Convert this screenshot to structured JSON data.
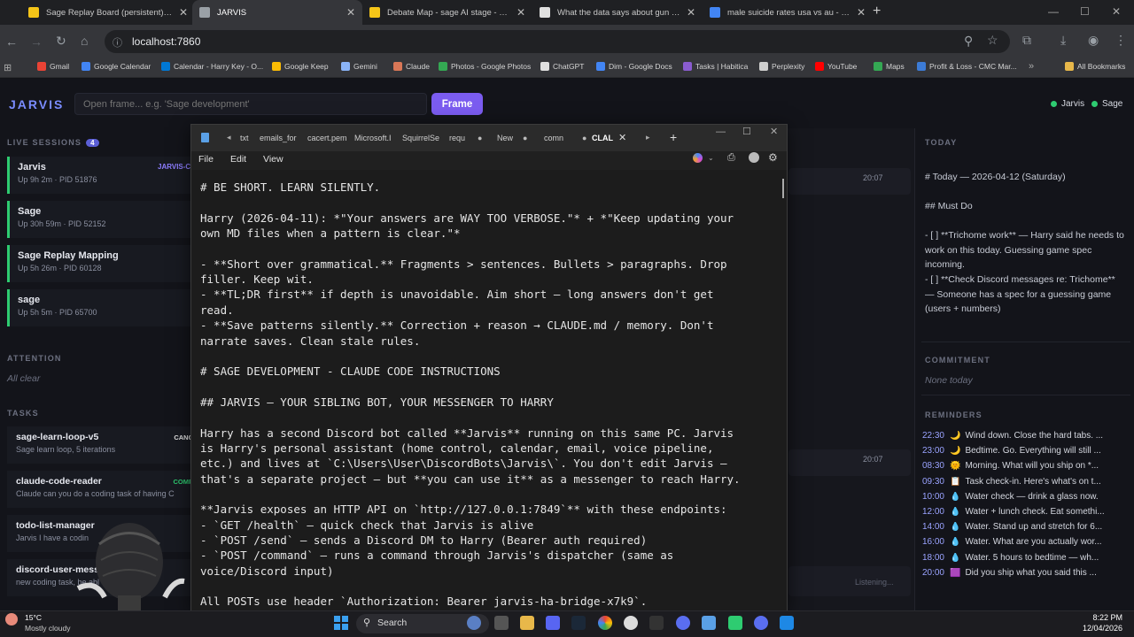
{
  "browser": {
    "tabs": [
      {
        "title": "Sage Replay Board (persistent) - Miro",
        "icon_color": "#f5c518"
      },
      {
        "title": "JARVIS",
        "icon_color": "#9aa0a6",
        "active": true
      },
      {
        "title": "Debate Map - sage AI stage - Miro",
        "icon_color": "#f5c518"
      },
      {
        "title": "What the data says about gun deaths",
        "icon_color": "#e0e0e0"
      },
      {
        "title": "male suicide rates usa vs au - Google",
        "icon_color": "#4285f4"
      }
    ],
    "url": "localhost:7860",
    "bookmarks": [
      {
        "label": "Gmail",
        "color": "#ea4335"
      },
      {
        "label": "Google Calendar",
        "color": "#4285f4"
      },
      {
        "label": "Calendar - Harry Key - O...",
        "color": "#0078d4"
      },
      {
        "label": "Google Keep",
        "color": "#fbbc04"
      },
      {
        "label": "Gemini",
        "color": "#8ab4f8"
      },
      {
        "label": "Claude",
        "color": "#d97757"
      },
      {
        "label": "Photos - Google Photos",
        "color": "#34a853"
      },
      {
        "label": "ChatGPT",
        "color": "#e0e0e0"
      },
      {
        "label": "Dim - Google Docs",
        "color": "#4285f4"
      },
      {
        "label": "Tasks | Habitica",
        "color": "#8a5cd0"
      },
      {
        "label": "Perplexity",
        "color": "#cfcfcf"
      },
      {
        "label": "YouTube",
        "color": "#ff0000"
      },
      {
        "label": "Maps",
        "color": "#34a853"
      },
      {
        "label": "Profit & Loss - CMC Mar...",
        "color": "#3c7bd6"
      }
    ],
    "all_bookmarks": "All Bookmarks"
  },
  "app": {
    "brand": "JARVIS",
    "frame_placeholder": "Open frame... e.g. 'Sage development'",
    "frame_button": "Frame",
    "status": [
      {
        "label": "Jarvis"
      },
      {
        "label": "Sage"
      }
    ]
  },
  "left": {
    "live_sessions_label": "LIVE SESSIONS",
    "live_sessions_count": "4",
    "sessions": [
      {
        "name": "Jarvis",
        "meta": "Up 9h 2m · PID 51876",
        "tag": "JARVIS-C"
      },
      {
        "name": "Sage",
        "meta": "Up 30h 59m · PID 52152"
      },
      {
        "name": "Sage Replay Mapping",
        "meta": "Up 5h 26m · PID 60128"
      },
      {
        "name": "sage",
        "meta": "Up 5h 5m · PID 65700"
      }
    ],
    "attention_label": "ATTENTION",
    "attention_value": "All clear",
    "tasks_label": "TASKS",
    "tasks": [
      {
        "name": "sage-learn-loop-v5",
        "meta": "Sage learn loop, 5 iterations",
        "badge": "CANC",
        "badge_color": "#e0e0e0"
      },
      {
        "name": "claude-code-reader",
        "meta": "Claude can you do a coding task of having C",
        "badge": "COMP",
        "badge_color": "#2ecc71"
      },
      {
        "name": "todo-list-manager",
        "meta": "Jarvis I have a codin",
        "badge": "",
        "badge_color": "#2ecc71"
      },
      {
        "name": "discord-user-messag",
        "meta": "new coding task, be abl",
        "badge": "",
        "badge_color": "#2ecc71"
      }
    ]
  },
  "center": {
    "time1": "20:07",
    "time2": "20:07",
    "listening": "Listening..."
  },
  "notepad": {
    "tabs": [
      "txt",
      "emails_for",
      "cacert.pem",
      "Microsoft.I",
      "SquirrelSe",
      "requ",
      "New",
      "comn",
      "CLAL"
    ],
    "menu": [
      "File",
      "Edit",
      "View"
    ],
    "lines": [
      "# BE SHORT. LEARN SILENTLY.",
      "",
      "Harry (2026-04-11): *\"Your answers are WAY TOO VERBOSE.\"* + *\"Keep updating your",
      "own MD files when a pattern is clear.\"*",
      "",
      "- **Short over grammatical.** Fragments > sentences. Bullets > paragraphs. Drop",
      "filler. Keep wit.",
      "- **TL;DR first** if depth is unavoidable. Aim short — long answers don't get",
      "read.",
      "- **Save patterns silently.** Correction + reason → CLAUDE.md / memory. Don't",
      "narrate saves. Clean stale rules.",
      "",
      "# SAGE DEVELOPMENT - CLAUDE CODE INSTRUCTIONS",
      "",
      "## JARVIS — YOUR SIBLING BOT, YOUR MESSENGER TO HARRY",
      "",
      "Harry has a second Discord bot called **Jarvis** running on this same PC. Jarvis",
      "is Harry's personal assistant (home control, calendar, email, voice pipeline,",
      "etc.) and lives at `C:\\Users\\User\\DiscordBots\\Jarvis\\`. You don't edit Jarvis —",
      "that's a separate project — but **you can use it** as a messenger to reach Harry.",
      "",
      "**Jarvis exposes an HTTP API on `http://127.0.0.1:7849`** with these endpoints:",
      "- `GET /health` — quick check that Jarvis is alive",
      "- `POST /send` — sends a Discord DM to Harry (Bearer auth required)",
      "- `POST /command` — runs a command through Jarvis's dispatcher (same as",
      "voice/Discord input)",
      "",
      "All POSTs use header `Authorization: Bearer jarvis-ha-bridge-x7k9`."
    ]
  },
  "right": {
    "today_label": "TODAY",
    "today_lines": [
      "# Today — 2026-04-12 (Saturday)",
      "## Must Do",
      "- [ ] **Trichome work** — Harry said he needs to work on this today. Guessing game spec incoming.",
      "- [ ] **Check Discord messages re: Trichome** — Someone has a spec for a guessing game (users + numbers)"
    ],
    "commitment_label": "COMMITMENT",
    "commitment_value": "None today",
    "reminders_label": "REMINDERS",
    "reminders": [
      {
        "time": "22:30",
        "emoji": "🌙",
        "text": "Wind down. Close the hard tabs. ..."
      },
      {
        "time": "23:00",
        "emoji": "🌙",
        "text": "Bedtime. Go. Everything will still ..."
      },
      {
        "time": "08:30",
        "emoji": "🌞",
        "text": "Morning. What will you ship on *..."
      },
      {
        "time": "09:30",
        "emoji": "📋",
        "text": "Task check-in. Here's what's on t..."
      },
      {
        "time": "10:00",
        "emoji": "💧",
        "text": "Water check — drink a glass now."
      },
      {
        "time": "12:00",
        "emoji": "💧",
        "text": "Water + lunch check. Eat somethi..."
      },
      {
        "time": "14:00",
        "emoji": "💧",
        "text": "Water. Stand up and stretch for 6..."
      },
      {
        "time": "16:00",
        "emoji": "💧",
        "text": "Water. What are you actually wor..."
      },
      {
        "time": "18:00",
        "emoji": "💧",
        "text": "Water. 5 hours to bedtime — wh..."
      },
      {
        "time": "20:00",
        "emoji": "🟪",
        "text": "Did you ship what you said this ..."
      }
    ]
  },
  "taskbar": {
    "weather_temp": "15°C",
    "weather_desc": "Mostly cloudy",
    "search": "Search",
    "time": "8:22 PM",
    "date": "12/04/2026"
  }
}
